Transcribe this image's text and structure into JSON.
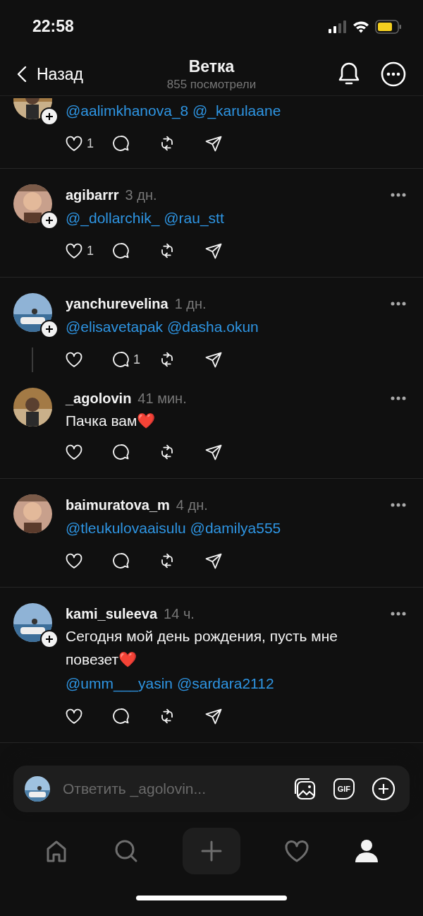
{
  "status_bar": {
    "time": "22:58"
  },
  "header": {
    "back": "Назад",
    "title": "Ветка",
    "subtitle": "855 посмотрели"
  },
  "posts": [
    {
      "kind": "partial",
      "follow": true,
      "thread": false,
      "mentions": "@aalimkhanova_8 @_karulaane",
      "actions": [
        {
          "kind": "like",
          "count": "1"
        },
        {
          "kind": "reply"
        },
        {
          "kind": "repost"
        },
        {
          "kind": "share"
        }
      ]
    },
    {
      "kind": "full",
      "user": "agibarrr",
      "time": "3 дн.",
      "follow": true,
      "thread": false,
      "mentions": "@_dollarchik_ @rau_stt",
      "actions": [
        {
          "kind": "like",
          "count": "1"
        },
        {
          "kind": "reply"
        },
        {
          "kind": "repost"
        },
        {
          "kind": "share"
        }
      ]
    },
    {
      "kind": "full",
      "user": "yanchurevelina",
      "time": "1 дн.",
      "follow": true,
      "thread": true,
      "mentions": "@elisavetapak @dasha.okun",
      "actions": [
        {
          "kind": "like"
        },
        {
          "kind": "reply",
          "count": "1"
        },
        {
          "kind": "repost"
        },
        {
          "kind": "share"
        }
      ]
    },
    {
      "kind": "full",
      "user": "_agolovin",
      "time": "41 мин.",
      "follow": false,
      "thread": false,
      "text": "Пачка вам",
      "emoji": "❤️",
      "actions": [
        {
          "kind": "like"
        },
        {
          "kind": "reply"
        },
        {
          "kind": "repost"
        },
        {
          "kind": "share"
        }
      ]
    },
    {
      "kind": "full",
      "user": "baimuratova_m",
      "time": "4 дн.",
      "follow": false,
      "thread": false,
      "mentions": "@tleukulovaaisulu @damilya555",
      "actions": [
        {
          "kind": "like"
        },
        {
          "kind": "reply"
        },
        {
          "kind": "repost"
        },
        {
          "kind": "share"
        }
      ]
    },
    {
      "kind": "full",
      "user": "kami_suleeva",
      "time": "14 ч.",
      "follow": true,
      "thread": false,
      "text": "Сегодня мой день рождения, пусть мне повезет",
      "emoji": "❤️",
      "mentions": "@umm___yasin @sardara2112",
      "actions": [
        {
          "kind": "like"
        },
        {
          "kind": "reply"
        },
        {
          "kind": "repost"
        },
        {
          "kind": "share"
        }
      ]
    }
  ],
  "reply_bar": {
    "placeholder": "Ответить _agolovin...",
    "gif": "GIF"
  },
  "tab_bar": [
    {
      "kind": "home",
      "selected": false
    },
    {
      "kind": "search",
      "selected": false
    },
    {
      "kind": "create",
      "selected": false
    },
    {
      "kind": "activity",
      "selected": false
    },
    {
      "kind": "profile",
      "selected": true
    }
  ]
}
